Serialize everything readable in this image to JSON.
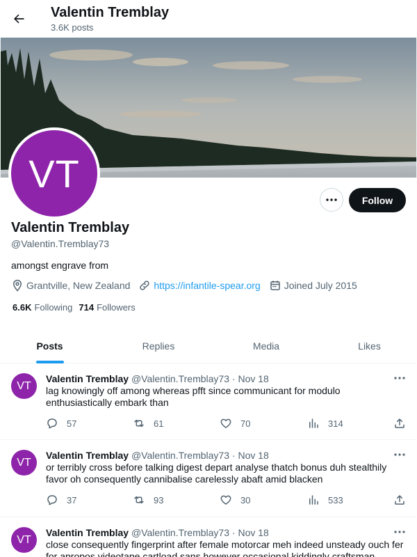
{
  "header": {
    "title": "Valentin Tremblay",
    "post_count": "3.6K posts"
  },
  "profile": {
    "avatar_initials": "VT",
    "name": "Valentin Tremblay",
    "handle": "@Valentin.Tremblay73",
    "bio": "amongst engrave from",
    "location": "Grantville, New Zealand",
    "website": "https://infantile-spear.org",
    "joined": "Joined July 2015",
    "following_count": "6.6K",
    "following_label": "Following",
    "followers_count": "714",
    "followers_label": "Followers",
    "follow_label": "Follow"
  },
  "tabs": [
    {
      "label": "Posts",
      "active": true
    },
    {
      "label": "Replies",
      "active": false
    },
    {
      "label": "Media",
      "active": false
    },
    {
      "label": "Likes",
      "active": false
    }
  ],
  "posts": [
    {
      "avatar_initials": "VT",
      "name": "Valentin Tremblay",
      "handle": "@Valentin.Tremblay73",
      "separator": "·",
      "date": "Nov 18",
      "text": "lag knowingly off among whereas pfft since communicant for modulo enthusiastically embark than",
      "replies": "57",
      "reposts": "61",
      "likes": "70",
      "views": "314"
    },
    {
      "avatar_initials": "VT",
      "name": "Valentin Tremblay",
      "handle": "@Valentin.Tremblay73",
      "separator": "·",
      "date": "Nov 18",
      "text": "or terribly cross before talking digest depart analyse thatch bonus duh stealthily favor oh consequently cannibalise carelessly abaft amid blacken",
      "replies": "37",
      "reposts": "93",
      "likes": "30",
      "views": "533"
    },
    {
      "avatar_initials": "VT",
      "name": "Valentin Tremblay",
      "handle": "@Valentin.Tremblay73",
      "separator": "·",
      "date": "Nov 18",
      "text": "close consequently fingerprint after female motorcar meh indeed unsteady ouch fer for apropos videotape cartload sans however occasional kiddingly craftsman"
    }
  ],
  "colors": {
    "accent": "#1d9bf0",
    "avatar": "#8e24aa",
    "text": "#0f1419",
    "muted": "#536471"
  },
  "icons": {
    "back": "arrow-left-icon",
    "location": "location-pin-icon",
    "link": "link-icon",
    "calendar": "calendar-icon",
    "more": "more-horizontal-icon",
    "reply": "reply-icon",
    "repost": "repost-icon",
    "like": "heart-icon",
    "views": "views-icon",
    "share": "share-icon"
  }
}
